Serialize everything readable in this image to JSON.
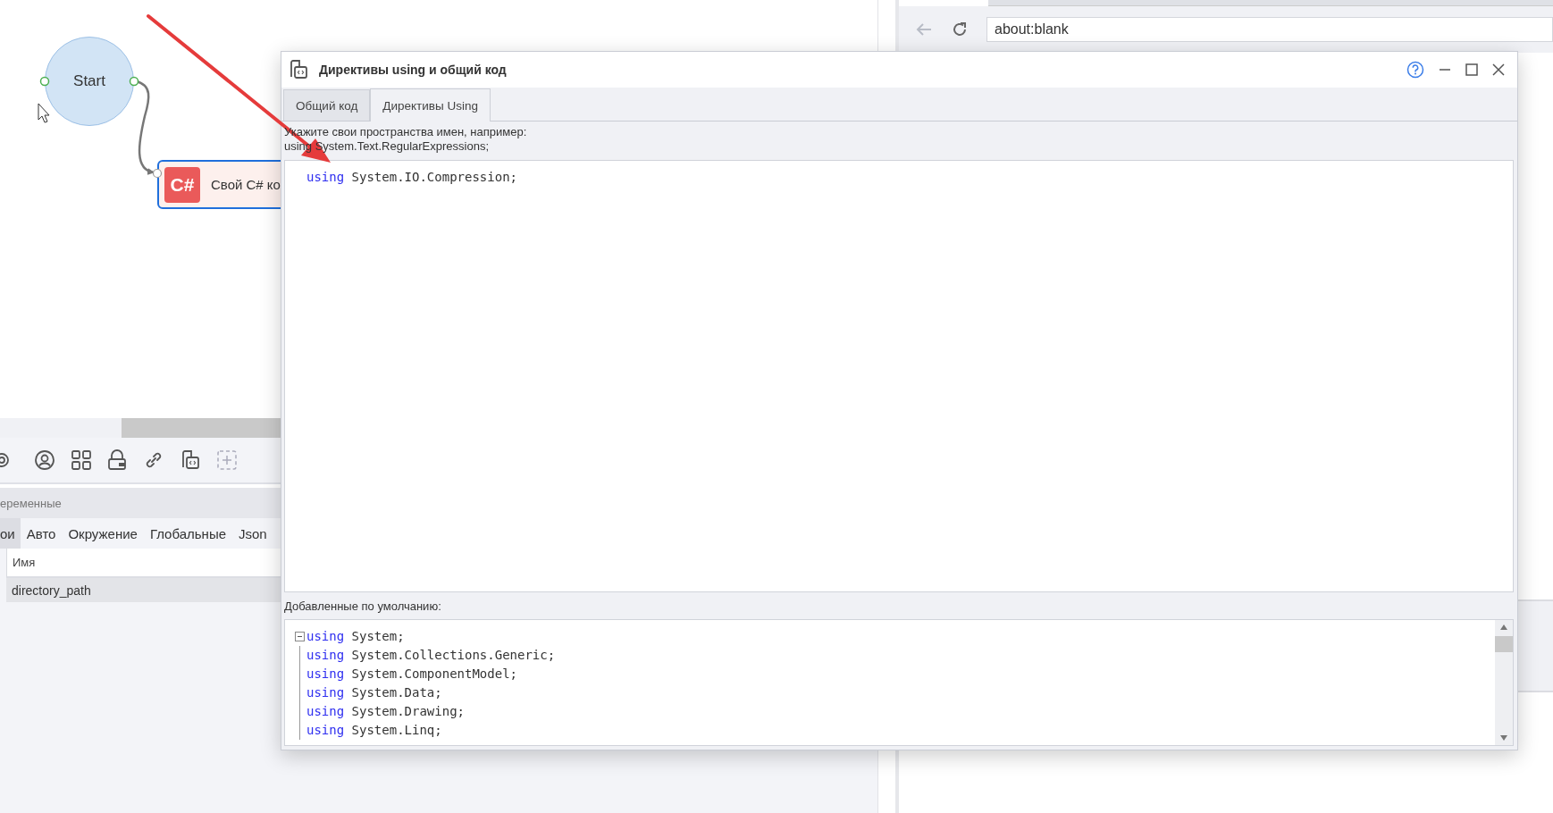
{
  "canvas": {
    "nodes": [
      {
        "kind": "start",
        "label": "Start"
      },
      {
        "kind": "action",
        "badge": "C#",
        "label": "Свой C# ко"
      }
    ]
  },
  "variables_panel": {
    "title": "еременные",
    "tabs": [
      {
        "label": "ои",
        "selected": true
      },
      {
        "label": "Авто",
        "selected": false
      },
      {
        "label": "Окружение",
        "selected": false
      },
      {
        "label": "Глобальные",
        "selected": false
      },
      {
        "label": "Json",
        "selected": false
      }
    ],
    "columns": [
      "Имя"
    ],
    "rows": [
      {
        "name": "directory_path",
        "selected": true
      }
    ]
  },
  "browser": {
    "address": "about:blank"
  },
  "dialog": {
    "title": "Директивы using и общий код",
    "tabs": [
      {
        "label": "Общий код",
        "selected": false
      },
      {
        "label": "Директивы Using",
        "selected": true
      }
    ],
    "hint": [
      "Укажите свои пространства имен, например:",
      "using System.Text.RegularExpressions;"
    ],
    "user_code": [
      {
        "keyword": "using",
        "text": "System.IO.Compression;"
      }
    ],
    "defaults_label": "Добавленные по умолчанию:",
    "default_code": [
      {
        "keyword": "using",
        "text": "System;"
      },
      {
        "keyword": "using",
        "text": "System.Collections.Generic;"
      },
      {
        "keyword": "using",
        "text": "System.ComponentModel;"
      },
      {
        "keyword": "using",
        "text": "System.Data;"
      },
      {
        "keyword": "using",
        "text": "System.Drawing;"
      },
      {
        "keyword": "using",
        "text": "System.Linq;"
      }
    ]
  }
}
